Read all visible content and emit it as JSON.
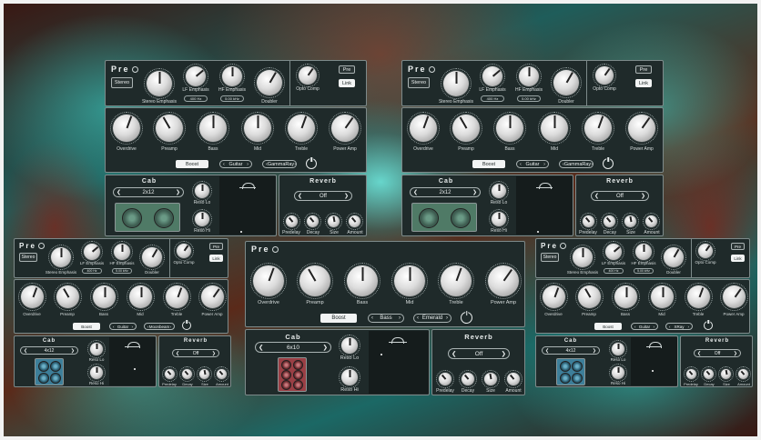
{
  "plugins": [
    {
      "title": "Pre",
      "stereo": "Stereo",
      "top_knob_labels": [
        "Stereo Emphasis",
        "LF Emphasis",
        "HF Emphasis",
        "Doubler"
      ],
      "lf_value": "400 Hz",
      "hf_value": "5.00 kHz",
      "opto": "Opto Comp",
      "pre_btn": "Pre",
      "link_btn": "Link",
      "amp_knobs": [
        "Overdrive",
        "Preamp",
        "Bass",
        "Mid",
        "Treble",
        "Power Amp"
      ],
      "boost": "Boost",
      "sel1": "Guitar",
      "sel2": "GammaRay",
      "cab_title": "Cab",
      "cab_model": "2x12",
      "reso_lo": "Reso Lo",
      "reso_hi": "Reso Hi",
      "reverb_title": "Reverb",
      "reverb_mode": "Off",
      "reverb_knobs": [
        "Predelay",
        "Decay",
        "Size",
        "Amount"
      ]
    },
    {
      "title": "Pre",
      "stereo": "Stereo",
      "top_knob_labels": [
        "Stereo Emphasis",
        "LF Emphasis",
        "HF Emphasis",
        "Doubler"
      ],
      "lf_value": "400 Hz",
      "hf_value": "5.00 kHz",
      "opto": "Opto Comp",
      "pre_btn": "Pre",
      "link_btn": "Link",
      "amp_knobs": [
        "Overdrive",
        "Preamp",
        "Bass",
        "Mid",
        "Treble",
        "Power Amp"
      ],
      "boost": "Boost",
      "sel1": "Guitar",
      "sel2": "GammaRay",
      "cab_title": "Cab",
      "cab_model": "2x12",
      "reso_lo": "Reso Lo",
      "reso_hi": "Reso Hi",
      "reverb_title": "Reverb",
      "reverb_mode": "Off",
      "reverb_knobs": [
        "Predelay",
        "Decay",
        "Size",
        "Amount"
      ]
    },
    {
      "title": "Pre",
      "stereo": "Stereo",
      "top_knob_labels": [
        "Stereo Emphasis",
        "LF Emphasis",
        "HF Emphasis",
        "Doubler"
      ],
      "lf_value": "400 Hz",
      "hf_value": "5.00 kHz",
      "opto": "Opto Comp",
      "pre_btn": "Pre",
      "link_btn": "Link",
      "amp_knobs": [
        "Overdrive",
        "Preamp",
        "Bass",
        "Mid",
        "Treble",
        "Power Amp"
      ],
      "boost": "Boost",
      "sel1": "Guitar",
      "sel2": "Moonbeam",
      "cab_title": "Cab",
      "cab_model": "4x12",
      "reso_lo": "Reso Lo",
      "reso_hi": "Reso Hi",
      "reverb_title": "Reverb",
      "reverb_mode": "Off",
      "reverb_knobs": [
        "Predelay",
        "Decay",
        "Size",
        "Amount"
      ]
    },
    {
      "title": "Pre",
      "amp_knobs": [
        "Overdrive",
        "Preamp",
        "Bass",
        "Mid",
        "Treble",
        "Power Amp"
      ],
      "boost": "Boost",
      "sel1": "Bass",
      "sel2": "Emerald",
      "cab_title": "Cab",
      "cab_model": "6x10",
      "reso_lo": "Reso Lo",
      "reso_hi": "Reso Hi",
      "reverb_title": "Reverb",
      "reverb_mode": "Off",
      "reverb_knobs": [
        "Predelay",
        "Decay",
        "Size",
        "Amount"
      ]
    },
    {
      "title": "Pre",
      "stereo": "Stereo",
      "top_knob_labels": [
        "Stereo Emphasis",
        "LF Emphasis",
        "HF Emphasis",
        "Doubler"
      ],
      "lf_value": "400 Hz",
      "hf_value": "5.00 kHz",
      "opto": "Opto Comp",
      "pre_btn": "Pre",
      "link_btn": "Link",
      "amp_knobs": [
        "Overdrive",
        "Preamp",
        "Bass",
        "Mid",
        "Treble",
        "Power Amp"
      ],
      "boost": "Boost",
      "sel1": "Guitar",
      "sel2": "XRay",
      "cab_title": "Cab",
      "cab_model": "4x12",
      "reso_lo": "Reso Lo",
      "reso_hi": "Reso Hi",
      "reverb_title": "Reverb",
      "reverb_mode": "Off",
      "reverb_knobs": [
        "Predelay",
        "Decay",
        "Size",
        "Amount"
      ]
    }
  ],
  "icons": {
    "arrow_left": "‹",
    "arrow_right": "›",
    "chevron_left": "❮",
    "chevron_right": "❯"
  },
  "colors": {
    "panel": "#1f2a2a",
    "cab_green": "#4f7a66",
    "cab_blue": "#3d7f9a",
    "cab_red": "#9a3f45"
  }
}
